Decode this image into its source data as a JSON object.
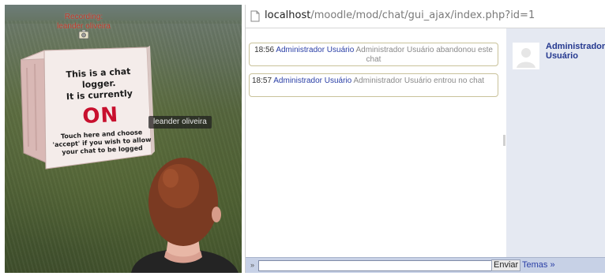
{
  "left_view": {
    "recording_label": "Recording:",
    "recording_user": "leander oliveira",
    "cube": {
      "title_line1": "This is a chat logger.",
      "title_line2": "It is currently",
      "status": "ON",
      "instruction_line1": "Touch here and choose",
      "instruction_line2": "'accept' if you wish to allow",
      "instruction_line3": "your chat to be logged"
    },
    "avatar_name_tag": "leander oliveira"
  },
  "browser": {
    "url_host": "localhost",
    "url_path": "/moodle/mod/chat/gui_ajax/index.php?id=1",
    "messages": [
      {
        "time": "18:56",
        "user": "Administrador Usuário",
        "text": "Administrador Usuário abandonou este chat"
      },
      {
        "time": "18:57",
        "user": "Administrador Usuário",
        "text": "Administrador Usuário entrou no chat"
      }
    ],
    "user_panel": {
      "name_line1": "Administrador",
      "name_line2": "Usuário"
    },
    "send_bar": {
      "arrow": "»",
      "input_value": "",
      "send_label": "Enviar",
      "themes_label": "Temas »"
    }
  }
}
